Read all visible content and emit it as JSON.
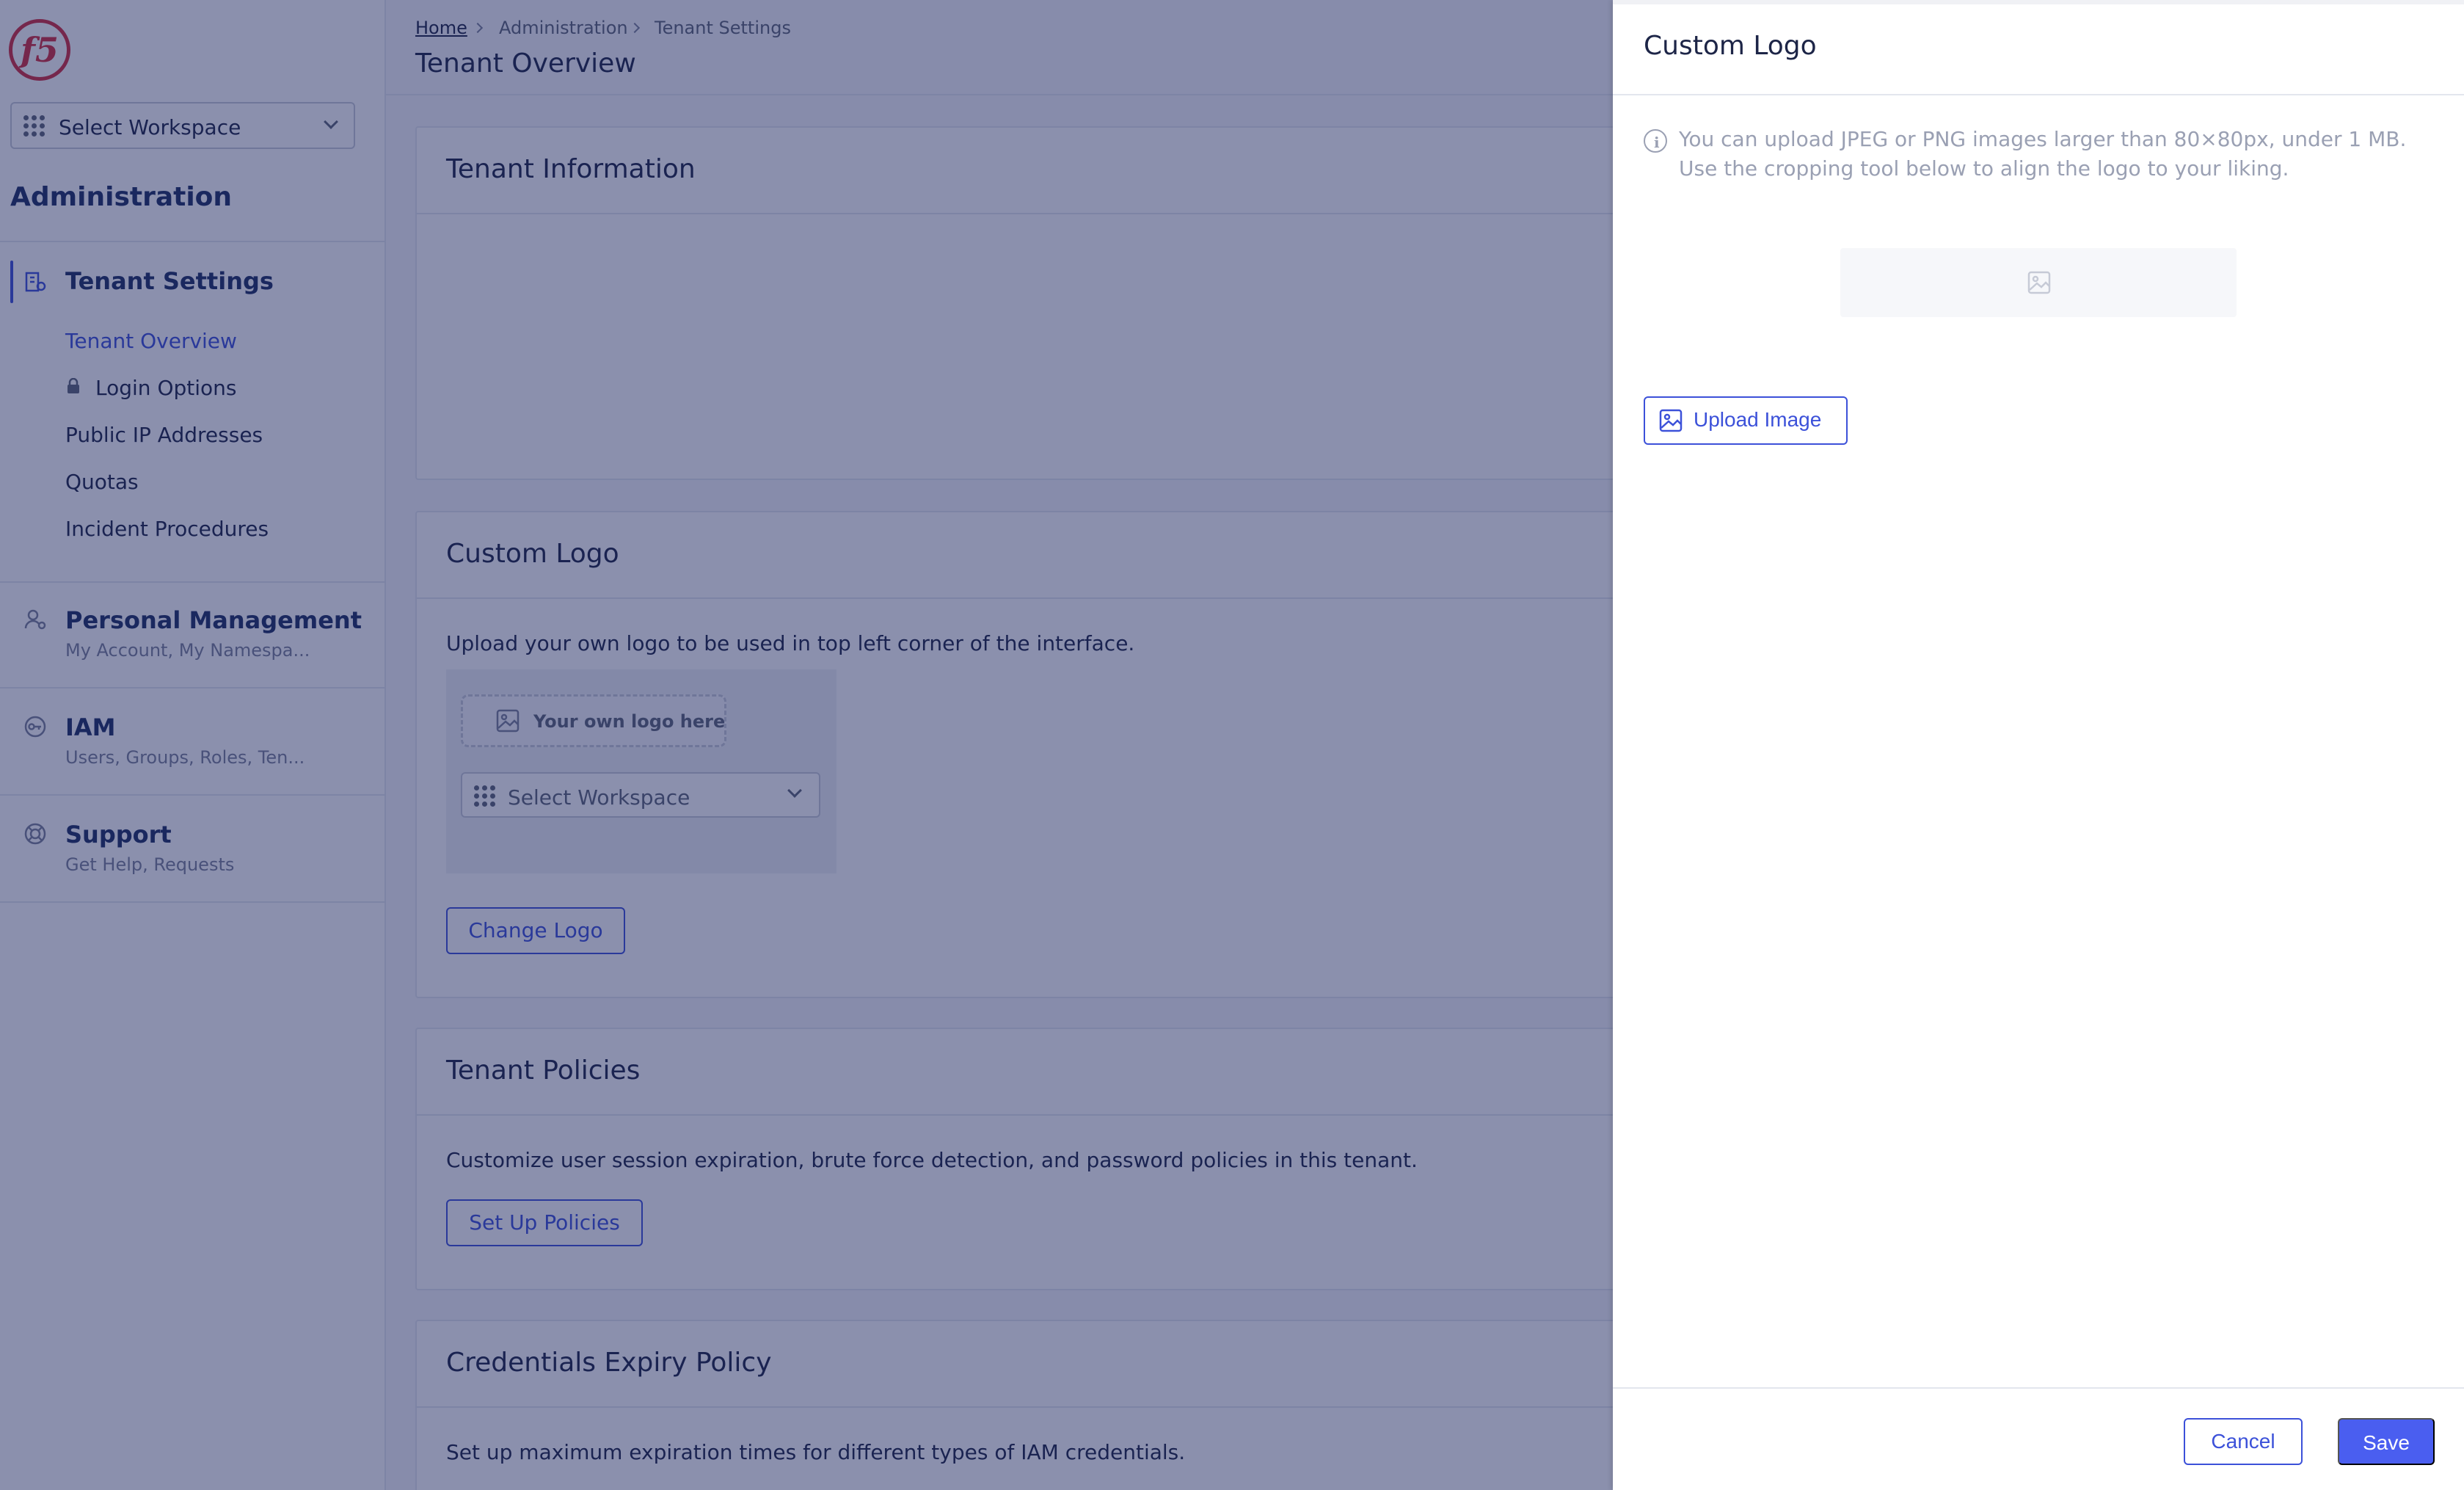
{
  "brand": {
    "logo_text": "f5",
    "accent": "#3c51d9",
    "logo_color": "#d22d3d"
  },
  "sidebar": {
    "workspace_label": "Select Workspace",
    "section_title": "Administration",
    "tenant_settings": {
      "label": "Tenant Settings",
      "items": [
        {
          "label": "Tenant Overview",
          "active": true
        },
        {
          "label": "Login Options",
          "locked": true
        },
        {
          "label": "Public IP Addresses"
        },
        {
          "label": "Quotas"
        },
        {
          "label": "Incident Procedures"
        }
      ]
    },
    "groups": [
      {
        "label": "Personal Management",
        "sub": "My Account, My Namespa...",
        "icon": "user-gear-icon"
      },
      {
        "label": "IAM",
        "sub": "Users, Groups, Roles, Ten...",
        "icon": "key-icon"
      },
      {
        "label": "Support",
        "sub": "Get Help, Requests",
        "icon": "lifebuoy-icon"
      }
    ]
  },
  "breadcrumb": [
    "Home",
    "Administration",
    "Tenant Settings"
  ],
  "page_title": "Tenant Overview",
  "cards": {
    "tenant_information": {
      "title": "Tenant Information"
    },
    "custom_logo": {
      "title": "Custom Logo",
      "description": "Upload your own logo to be used in top left corner of the interface.",
      "preview_logo_text": "Your own logo here",
      "preview_workspace": "Select Workspace",
      "button": "Change Logo"
    },
    "tenant_policies": {
      "title": "Tenant Policies",
      "description": "Customize user session expiration, brute force detection, and password policies in this tenant.",
      "button": "Set Up Policies"
    },
    "credentials_expiry": {
      "title": "Credentials Expiry Policy",
      "description": "Set up maximum expiration times for different types of IAM credentials."
    }
  },
  "drawer": {
    "title": "Custom Logo",
    "info": "You can upload JPEG or PNG images larger than 80×80px, under 1 MB. Use the cropping tool below to align the logo to your liking.",
    "upload_button": "Upload Image",
    "cancel_button": "Cancel",
    "save_button": "Save"
  }
}
